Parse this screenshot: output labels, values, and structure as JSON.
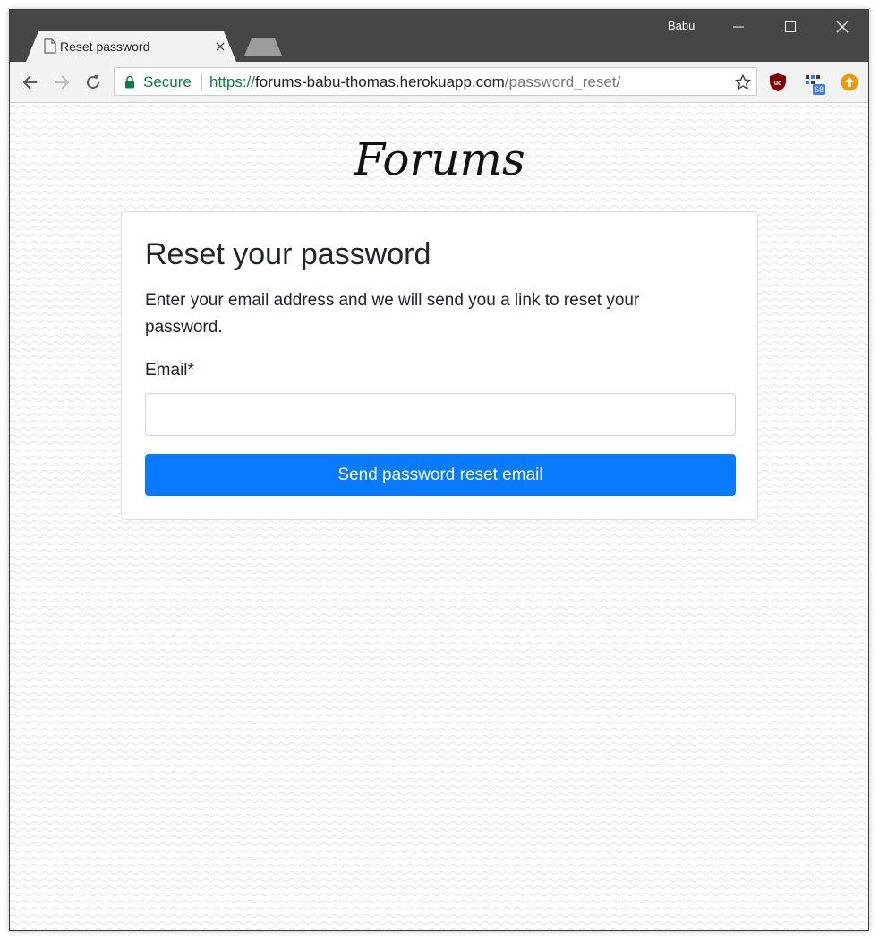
{
  "browser": {
    "profile_name": "Babu",
    "tab": {
      "title": "Reset password"
    },
    "omnibox": {
      "secure_label": "Secure",
      "url_scheme": "https://",
      "url_host": "forums-babu-thomas.herokuapp.com",
      "url_path": "/password_reset/"
    },
    "extensions": [
      {
        "icon": "ublock-origin-icon",
        "badge": ""
      },
      {
        "icon": "extension-grid-icon",
        "badge": "68"
      },
      {
        "icon": "orange-update-icon",
        "badge": ""
      }
    ]
  },
  "page": {
    "logo_text": "Forums",
    "card": {
      "title": "Reset your password",
      "description": "Enter your email address and we will send you a link to reset your password.",
      "email_label": "Email*",
      "email_value": "",
      "submit_label": "Send password reset email"
    }
  },
  "colors": {
    "primary_button": "#087bff",
    "secure_green": "#0b8043",
    "titlebar": "#464646"
  }
}
